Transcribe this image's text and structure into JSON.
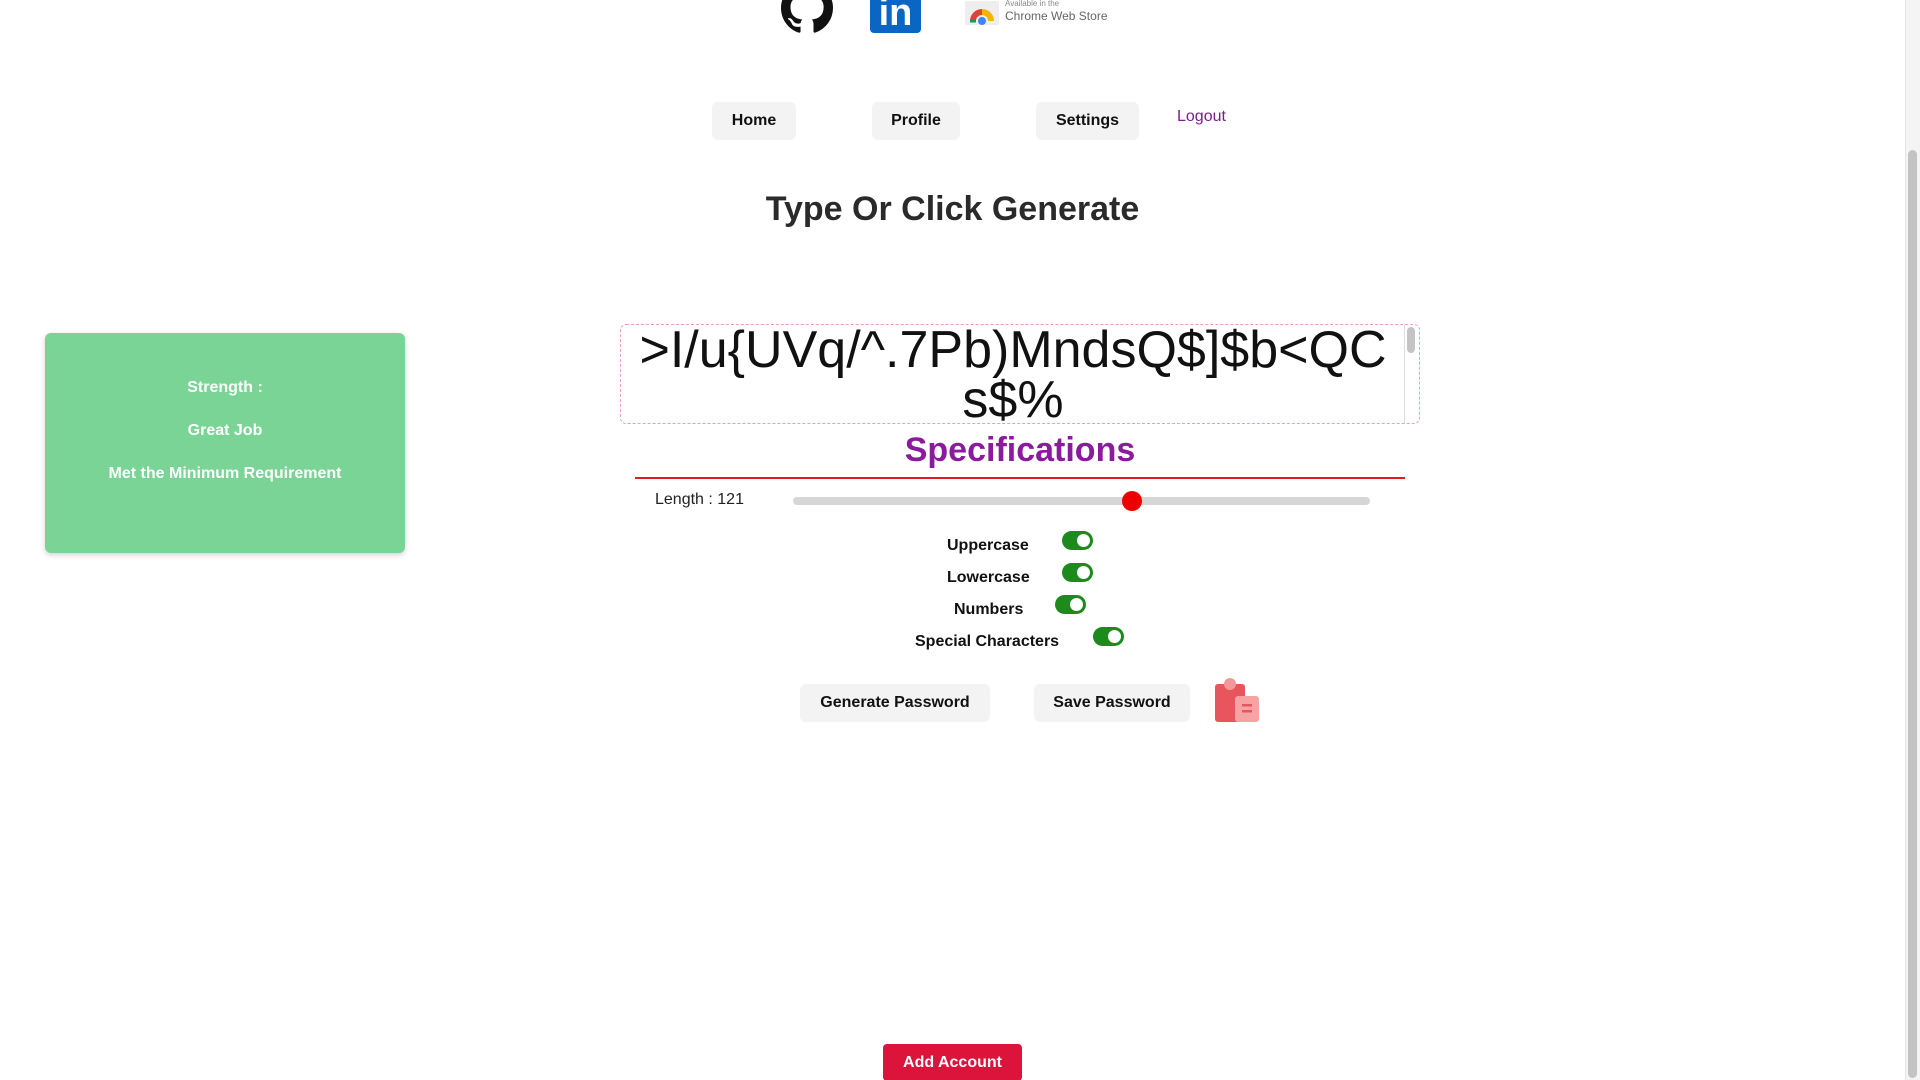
{
  "brand": {
    "github_icon": "github-icon",
    "linkedin_text": "in",
    "chrome_store_small": "Available in the",
    "chrome_store_label": "Chrome Web Store"
  },
  "nav": {
    "home": "Home",
    "profile": "Profile",
    "settings": "Settings",
    "logout": "Logout"
  },
  "heading": "Type Or Click Generate",
  "strength": {
    "title": "Strength :",
    "rating": "Great Job",
    "message": "Met the Minimum Requirement"
  },
  "password": {
    "value": ">I/u{UVq/^.7Pb)MndsQ$]$b<QCs$%"
  },
  "specifications": {
    "title": "Specifications",
    "length_label": "Length : 121",
    "length_slider_fraction": 0.587,
    "options": [
      {
        "label": "Uppercase",
        "enabled": true
      },
      {
        "label": "Lowercase",
        "enabled": true
      },
      {
        "label": "Numbers",
        "enabled": true
      },
      {
        "label": "Special Characters",
        "enabled": true
      }
    ]
  },
  "actions": {
    "generate": "Generate Password",
    "save": "Save Password",
    "copy_icon": "clipboard-icon"
  },
  "footer": {
    "add_account": "Add Account"
  },
  "colors": {
    "strength_bg": "#7ad495",
    "spec_title": "#8b1a9e",
    "spec_line": "#e31b23",
    "toggle_on": "#1d8a1d",
    "slider_thumb": "#ee0000",
    "add_account_bg": "#dc143c",
    "logout_text": "#7b1d8a"
  }
}
